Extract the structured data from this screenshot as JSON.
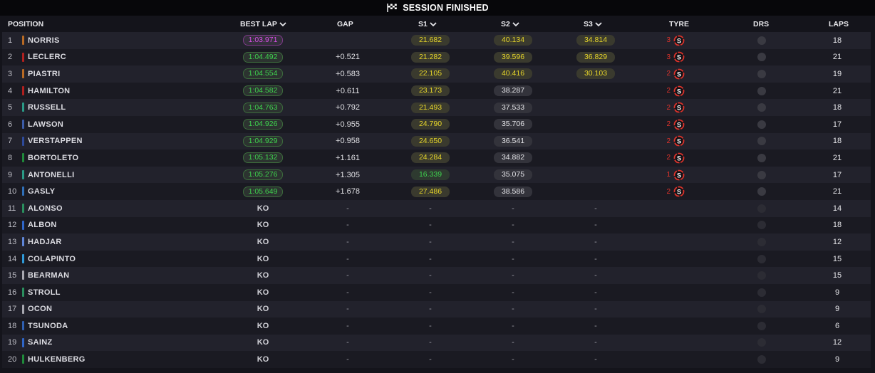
{
  "session_title": "SESSION FINISHED",
  "columns": {
    "position": "POSITION",
    "best_lap": "BEST LAP",
    "gap": "GAP",
    "s1": "S1",
    "s2": "S2",
    "s3": "S3",
    "tyre": "TYRE",
    "drs": "DRS",
    "laps": "LAPS"
  },
  "colors": {
    "purple": "#d94ee8",
    "green": "#3ed24e",
    "yellow": "#e6d52a",
    "tyre_red": "#e0332b"
  },
  "drivers": [
    {
      "pos": "1",
      "name": "NORRIS",
      "team_color": "#b86a24",
      "best_lap": "1:03.971",
      "best_style": "purple",
      "gap": "",
      "s1": "21.682",
      "s1_style": "yellow",
      "s2": "40.134",
      "s2_style": "yellow",
      "s3": "34.814",
      "s3_style": "yellow",
      "tyre_age": "3",
      "tyre": "S",
      "laps": "18"
    },
    {
      "pos": "2",
      "name": "LECLERC",
      "team_color": "#b0201f",
      "best_lap": "1:04.492",
      "best_style": "green",
      "gap": "+0.521",
      "s1": "21.282",
      "s1_style": "yellow",
      "s2": "39.596",
      "s2_style": "yellow",
      "s3": "36.829",
      "s3_style": "yellow",
      "tyre_age": "3",
      "tyre": "S",
      "laps": "21"
    },
    {
      "pos": "3",
      "name": "PIASTRI",
      "team_color": "#b86a24",
      "best_lap": "1:04.554",
      "best_style": "green",
      "gap": "+0.583",
      "s1": "22.105",
      "s1_style": "yellow",
      "s2": "40.416",
      "s2_style": "yellow",
      "s3": "30.103",
      "s3_style": "yellow",
      "tyre_age": "2",
      "tyre": "S",
      "laps": "19"
    },
    {
      "pos": "4",
      "name": "HAMILTON",
      "team_color": "#b0201f",
      "best_lap": "1:04.582",
      "best_style": "green",
      "gap": "+0.611",
      "s1": "23.173",
      "s1_style": "yellow",
      "s2": "38.287",
      "s2_style": "white",
      "s3": "",
      "s3_style": "",
      "tyre_age": "2",
      "tyre": "S",
      "laps": "21"
    },
    {
      "pos": "5",
      "name": "RUSSELL",
      "team_color": "#2a9a86",
      "best_lap": "1:04.763",
      "best_style": "green",
      "gap": "+0.792",
      "s1": "21.493",
      "s1_style": "yellow",
      "s2": "37.533",
      "s2_style": "white",
      "s3": "",
      "s3_style": "",
      "tyre_age": "2",
      "tyre": "S",
      "laps": "18"
    },
    {
      "pos": "6",
      "name": "LAWSON",
      "team_color": "#3c5ca8",
      "best_lap": "1:04.926",
      "best_style": "green",
      "gap": "+0.955",
      "s1": "24.790",
      "s1_style": "yellow",
      "s2": "35.706",
      "s2_style": "white",
      "s3": "",
      "s3_style": "",
      "tyre_age": "2",
      "tyre": "S",
      "laps": "17"
    },
    {
      "pos": "7",
      "name": "VERSTAPPEN",
      "team_color": "#2e4a9a",
      "best_lap": "1:04.929",
      "best_style": "green",
      "gap": "+0.958",
      "s1": "24.650",
      "s1_style": "yellow",
      "s2": "36.541",
      "s2_style": "white",
      "s3": "",
      "s3_style": "",
      "tyre_age": "2",
      "tyre": "S",
      "laps": "18"
    },
    {
      "pos": "8",
      "name": "BORTOLETO",
      "team_color": "#1f8a3a",
      "best_lap": "1:05.132",
      "best_style": "green",
      "gap": "+1.161",
      "s1": "24.284",
      "s1_style": "yellow",
      "s2": "34.882",
      "s2_style": "white",
      "s3": "",
      "s3_style": "",
      "tyre_age": "2",
      "tyre": "S",
      "laps": "21"
    },
    {
      "pos": "9",
      "name": "ANTONELLI",
      "team_color": "#2a9a86",
      "best_lap": "1:05.276",
      "best_style": "green",
      "gap": "+1.305",
      "s1": "16.339",
      "s1_style": "s-green",
      "s2": "35.075",
      "s2_style": "white",
      "s3": "",
      "s3_style": "",
      "tyre_age": "1",
      "tyre": "S",
      "laps": "17"
    },
    {
      "pos": "10",
      "name": "GASLY",
      "team_color": "#2f6fb8",
      "best_lap": "1:05.649",
      "best_style": "green",
      "gap": "+1.678",
      "s1": "27.486",
      "s1_style": "yellow",
      "s2": "38.586",
      "s2_style": "white",
      "s3": "",
      "s3_style": "",
      "tyre_age": "2",
      "tyre": "S",
      "laps": "21"
    },
    {
      "pos": "11",
      "name": "ALONSO",
      "team_color": "#2a8f5e",
      "best_lap": "KO",
      "best_style": "ko",
      "gap": "-",
      "s1": "-",
      "s1_style": "dash",
      "s2": "-",
      "s2_style": "dash",
      "s3": "-",
      "s3_style": "dash",
      "tyre_age": "",
      "tyre": "",
      "laps": "14"
    },
    {
      "pos": "12",
      "name": "ALBON",
      "team_color": "#2f66c8",
      "best_lap": "KO",
      "best_style": "ko",
      "gap": "-",
      "s1": "-",
      "s1_style": "dash",
      "s2": "-",
      "s2_style": "dash",
      "s3": "-",
      "s3_style": "dash",
      "tyre_age": "",
      "tyre": "",
      "laps": "18"
    },
    {
      "pos": "13",
      "name": "HADJAR",
      "team_color": "#5f86d8",
      "best_lap": "KO",
      "best_style": "ko",
      "gap": "-",
      "s1": "-",
      "s1_style": "dash",
      "s2": "-",
      "s2_style": "dash",
      "s3": "-",
      "s3_style": "dash",
      "tyre_age": "",
      "tyre": "",
      "laps": "12"
    },
    {
      "pos": "14",
      "name": "COLAPINTO",
      "team_color": "#2f9ad8",
      "best_lap": "KO",
      "best_style": "ko",
      "gap": "-",
      "s1": "-",
      "s1_style": "dash",
      "s2": "-",
      "s2_style": "dash",
      "s3": "-",
      "s3_style": "dash",
      "tyre_age": "",
      "tyre": "",
      "laps": "15"
    },
    {
      "pos": "15",
      "name": "BEARMAN",
      "team_color": "#a8a8b0",
      "best_lap": "KO",
      "best_style": "ko",
      "gap": "-",
      "s1": "-",
      "s1_style": "dash",
      "s2": "-",
      "s2_style": "dash",
      "s3": "-",
      "s3_style": "dash",
      "tyre_age": "",
      "tyre": "",
      "laps": "15"
    },
    {
      "pos": "16",
      "name": "STROLL",
      "team_color": "#2a8f5e",
      "best_lap": "KO",
      "best_style": "ko",
      "gap": "-",
      "s1": "-",
      "s1_style": "dash",
      "s2": "-",
      "s2_style": "dash",
      "s3": "-",
      "s3_style": "dash",
      "tyre_age": "",
      "tyre": "",
      "laps": "9"
    },
    {
      "pos": "17",
      "name": "OCON",
      "team_color": "#a8a8b0",
      "best_lap": "KO",
      "best_style": "ko",
      "gap": "-",
      "s1": "-",
      "s1_style": "dash",
      "s2": "-",
      "s2_style": "dash",
      "s3": "-",
      "s3_style": "dash",
      "tyre_age": "",
      "tyre": "",
      "laps": "9"
    },
    {
      "pos": "18",
      "name": "TSUNODA",
      "team_color": "#2f5fb0",
      "best_lap": "KO",
      "best_style": "ko",
      "gap": "-",
      "s1": "-",
      "s1_style": "dash",
      "s2": "-",
      "s2_style": "dash",
      "s3": "-",
      "s3_style": "dash",
      "tyre_age": "",
      "tyre": "",
      "laps": "6"
    },
    {
      "pos": "19",
      "name": "SAINZ",
      "team_color": "#2f66c8",
      "best_lap": "KO",
      "best_style": "ko",
      "gap": "-",
      "s1": "-",
      "s1_style": "dash",
      "s2": "-",
      "s2_style": "dash",
      "s3": "-",
      "s3_style": "dash",
      "tyre_age": "",
      "tyre": "",
      "laps": "12"
    },
    {
      "pos": "20",
      "name": "HULKENBERG",
      "team_color": "#1f8a3a",
      "best_lap": "KO",
      "best_style": "ko",
      "gap": "-",
      "s1": "-",
      "s1_style": "dash",
      "s2": "-",
      "s2_style": "dash",
      "s3": "-",
      "s3_style": "dash",
      "tyre_age": "",
      "tyre": "",
      "laps": "9"
    }
  ]
}
